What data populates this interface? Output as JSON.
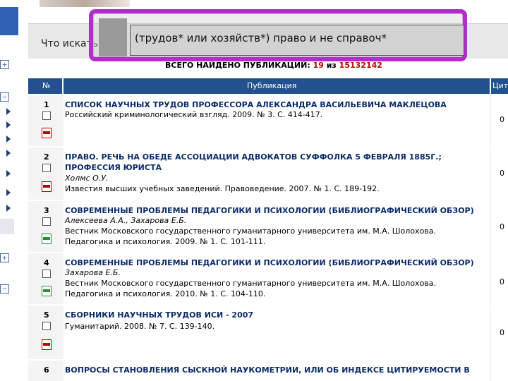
{
  "search": {
    "label": "Что искать",
    "query": "(трудов* или хозяйств*) право и не справоч*"
  },
  "summary": {
    "prefix": "ВСЕГО НАЙДЕНО ПУБЛИКАЦИЙ:",
    "found": "19",
    "of": "из",
    "total": "15132142"
  },
  "table": {
    "col_no": "№",
    "col_pub": "Публикация",
    "col_cit": "Цит"
  },
  "rows": [
    {
      "num": "1",
      "title": "СПИСОК НАУЧНЫХ ТРУДОВ ПРОФЕССОРА АЛЕКСАНДРА ВАСИЛЬЕВИЧА МАКЛЕЦОВА",
      "source": "Российский криминологический взгляд. 2009. № 3. С. 414-417.",
      "cit": "0"
    },
    {
      "num": "2",
      "title": "ПРАВО. РЕЧЬ НА ОБЕДЕ АССОЦИАЦИИ АДВОКАТОВ СУФФОЛКА 5 ФЕВРАЛЯ 1885Г.; ПРОФЕССИЯ ЮРИСТА",
      "authors": "Холмс О.У.",
      "source": "Известия высших учебных заведений. Правоведение. 2007. № 1. С. 189-192.",
      "cit": "0"
    },
    {
      "num": "3",
      "title": "СОВРЕМЕННЫЕ ПРОБЛЕМЫ ПЕДАГОГИКИ И ПСИХОЛОГИИ (БИБЛИОГРАФИЧЕСКИЙ ОБЗОР)",
      "authors": "Алексеева А.А., Захарова Е.Б.",
      "source1": "Вестник Московского государственного гуманитарного университета им. М.А. Шолохова.",
      "source2": "Педагогика и психология. 2009. № 1. С. 101-111.",
      "cit": "0"
    },
    {
      "num": "4",
      "title": "СОВРЕМЕННЫЕ ПРОБЛЕМЫ ПЕДАГОГИКИ И ПСИХОЛОГИИ (БИБЛИОГРАФИЧЕСКИЙ ОБЗОР)",
      "authors": "Захарова Е.Б.",
      "source1": "Вестник Московского государственного гуманитарного университета им. М.А. Шолохова.",
      "source2": "Педагогика и психология. 2010. № 1. С. 104-110.",
      "cit": "0"
    },
    {
      "num": "5",
      "title": "СБОРНИКИ НАУЧНЫХ ТРУДОВ ИСИ - 2007",
      "source": "Гуманитарий. 2008. № 7. С. 139-140.",
      "cit": "0"
    },
    {
      "num": "6",
      "title": "ВОПРОСЫ СТАНОВЛЕНИЯ СЫСКНОЙ НАУКОМЕТРИИ, ИЛИ ОБ ИНДЕКСЕ ЦИТИРУЕМОСТИ В"
    }
  ],
  "colors": {
    "header_bg": "#23518f",
    "highlight": "#b22ec9",
    "count_red": "#c00000"
  }
}
